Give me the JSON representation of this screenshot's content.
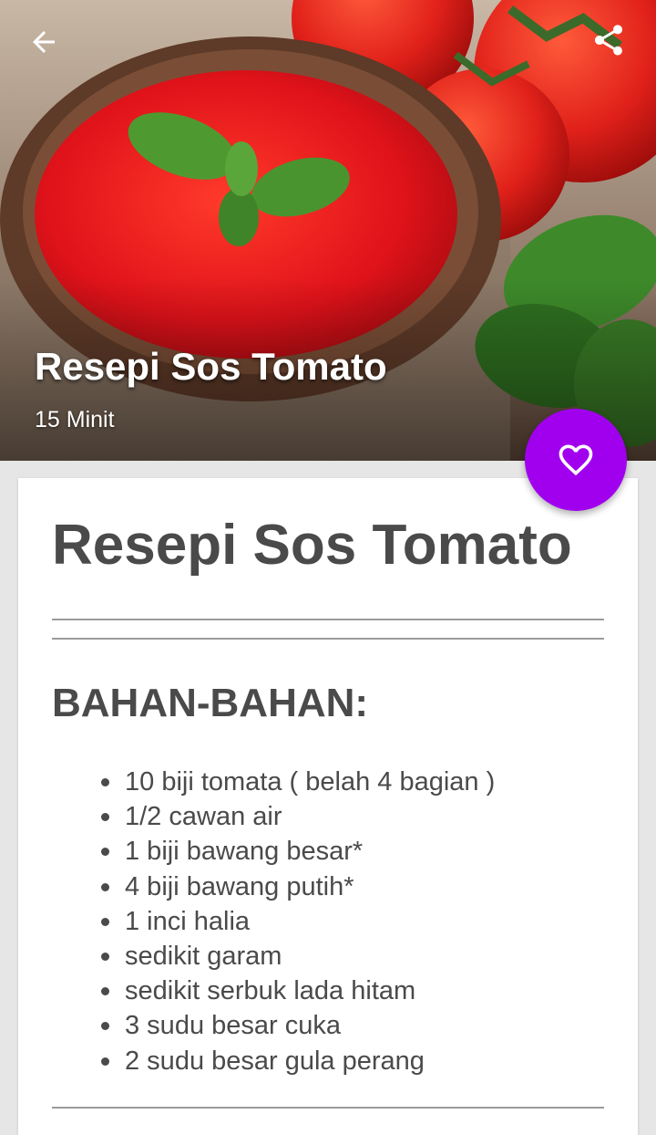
{
  "hero": {
    "title": "Resepi Sos Tomato",
    "duration": "15 Minit",
    "back_icon": "arrow-left-icon",
    "share_icon": "share-icon"
  },
  "fab": {
    "icon": "heart-outline-icon",
    "color": "#a100ef"
  },
  "card": {
    "title": "Resepi Sos Tomato",
    "section_title": "BAHAN-BAHAN:",
    "ingredients": [
      "10 biji tomata (  belah 4 bagian )",
      "1/2 cawan air",
      "1 biji bawang besar*",
      "4 biji bawang putih*",
      "1 inci halia",
      "sedikit garam",
      "sedikit serbuk lada hitam",
      "3 sudu besar cuka",
      "2 sudu besar gula perang"
    ]
  }
}
